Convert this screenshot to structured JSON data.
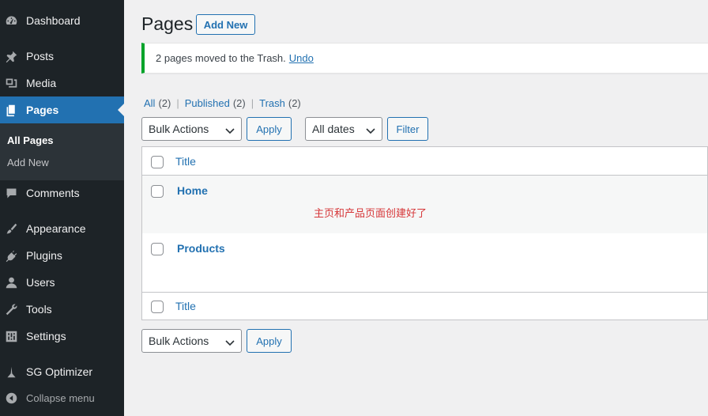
{
  "sidebar": {
    "items": [
      {
        "label": "Dashboard",
        "icon": "dashboard-icon"
      },
      {
        "label": "Posts",
        "icon": "pin-icon"
      },
      {
        "label": "Media",
        "icon": "media-icon"
      },
      {
        "label": "Pages",
        "icon": "pages-icon",
        "current": true
      },
      {
        "label": "Comments",
        "icon": "comment-icon"
      },
      {
        "label": "Appearance",
        "icon": "brush-icon"
      },
      {
        "label": "Plugins",
        "icon": "plugin-icon"
      },
      {
        "label": "Users",
        "icon": "user-icon"
      },
      {
        "label": "Tools",
        "icon": "wrench-icon"
      },
      {
        "label": "Settings",
        "icon": "settings-icon"
      },
      {
        "label": "SG Optimizer",
        "icon": "sg-optimizer-icon"
      }
    ],
    "submenu": [
      {
        "label": "All Pages",
        "active": true
      },
      {
        "label": "Add New"
      }
    ],
    "collapse_label": "Collapse menu"
  },
  "header": {
    "title": "Pages",
    "add_new_label": "Add New"
  },
  "notice": {
    "text": "2 pages moved to the Trash.",
    "undo_label": "Undo",
    "color": "#00a32a"
  },
  "filters": {
    "views": [
      {
        "label": "All",
        "count": "(2)"
      },
      {
        "label": "Published",
        "count": "(2)"
      },
      {
        "label": "Trash",
        "count": "(2)"
      }
    ],
    "bulk_actions_value": "Bulk Actions",
    "apply_label": "Apply",
    "dates_value": "All dates",
    "filter_label": "Filter"
  },
  "table": {
    "column_title": "Title",
    "rows": [
      {
        "title": "Home"
      },
      {
        "title": "Products"
      }
    ]
  },
  "annotation": "主页和产品页面创建好了",
  "colors": {
    "accent": "#2271b1",
    "sidebar_bg": "#1d2327",
    "annotation": "#d63638"
  }
}
